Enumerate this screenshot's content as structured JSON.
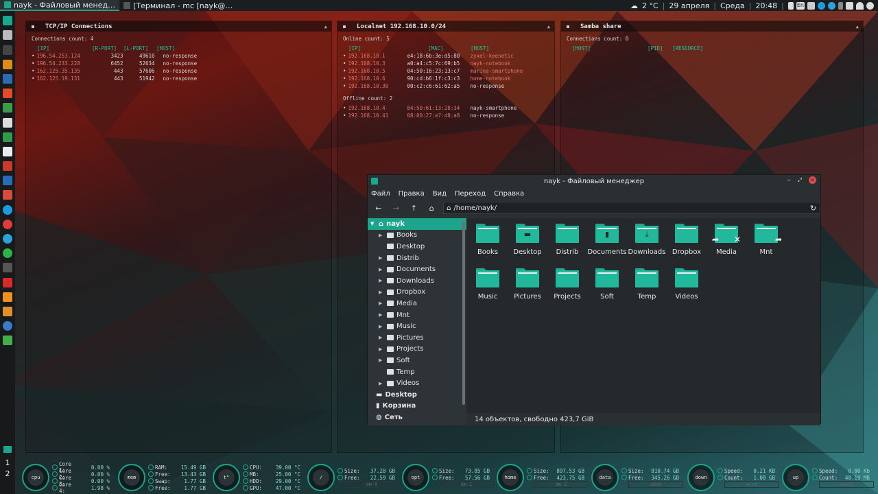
{
  "topbar": {
    "tasks": [
      {
        "label": "nayk - Файловый менед…",
        "active": true
      },
      {
        "label": "[Терминал - mc [nayk@…",
        "active": false
      }
    ],
    "weather": "2 °C",
    "date": "29 апреля",
    "weekday": "Среда",
    "time": "20:48",
    "lang": "En"
  },
  "workspaces": [
    "1",
    "2"
  ],
  "tcp_panel": {
    "title": "TCP/IP Connections",
    "count_label": "Connections count: 4",
    "headers": [
      "[IP]",
      "[R-PORT]",
      "[L-PORT]",
      "[HOST]"
    ],
    "rows": [
      {
        "ip": "196.54.253.124",
        "rport": "3423",
        "lport": "49610",
        "host": "no-response"
      },
      {
        "ip": "196.54.233.228",
        "rport": "6452",
        "lport": "52634",
        "host": "no-response"
      },
      {
        "ip": "162.125.35.135",
        "rport": "443",
        "lport": "57606",
        "host": "no-response"
      },
      {
        "ip": "162.125.19.131",
        "rport": "443",
        "lport": "51942",
        "host": "no-response"
      }
    ]
  },
  "lan_panel": {
    "title": "Localnet 192.168.10.0/24",
    "online_label": "Online count: 5",
    "headers": [
      "[IP]",
      "[MAC]",
      "[HOST]"
    ],
    "online": [
      {
        "ip": "192.168.10.1",
        "mac": "e4:18:6b:3e:d5:80",
        "host": "zyxel-keenetic"
      },
      {
        "ip": "192.168.10.3",
        "mac": "a0:a4:c5:7c:69:b5",
        "host": "nayk-notebook"
      },
      {
        "ip": "192.168.10.5",
        "mac": "04:50:16:23:13:c7",
        "host": "marina-smartphone"
      },
      {
        "ip": "192.168.10.6",
        "mac": "90:cd:b6:1f:c3:c3",
        "host": "home-notebook"
      },
      {
        "ip": "192.168.10.30",
        "mac": "00:c2:c6:61:62:a5",
        "host": "no-response"
      }
    ],
    "offline_label": "Offline count: 2",
    "offline": [
      {
        "ip": "192.168.10.4",
        "mac": "84:50:61:13:28:34",
        "host": "nayk-smartphone"
      },
      {
        "ip": "192.168.10.41",
        "mac": "08:00:27:e7:d8:a8",
        "host": "no-response"
      }
    ]
  },
  "samba_panel": {
    "title": "Samba share",
    "count_label": "Connections count: 0",
    "headers": [
      "[HOST]",
      "[PID]",
      "[RESOURCE]"
    ]
  },
  "filemanager": {
    "title": "nayk - Файловый менеджер",
    "menu": [
      "Файл",
      "Правка",
      "Вид",
      "Переход",
      "Справка"
    ],
    "path": "/home/nayk/",
    "sidebar": {
      "root": "nayk",
      "children": [
        "Books",
        "Desktop",
        "Distrib",
        "Documents",
        "Downloads",
        "Dropbox",
        "Media",
        "Mnt",
        "Music",
        "Pictures",
        "Projects",
        "Soft",
        "Temp",
        "Videos"
      ],
      "places": [
        "Desktop",
        "Корзина",
        "Сеть"
      ]
    },
    "folders": [
      {
        "name": "Books",
        "glyph": ""
      },
      {
        "name": "Desktop",
        "glyph": "▬"
      },
      {
        "name": "Distrib",
        "glyph": ""
      },
      {
        "name": "Documents",
        "glyph": "▮"
      },
      {
        "name": "Downloads",
        "glyph": "⤓"
      },
      {
        "name": "Dropbox",
        "glyph": ""
      },
      {
        "name": "Media",
        "glyph": ""
      },
      {
        "name": "Mnt",
        "glyph": ""
      },
      {
        "name": "Music",
        "glyph": ""
      },
      {
        "name": "Pictures",
        "glyph": ""
      },
      {
        "name": "Projects",
        "glyph": ""
      },
      {
        "name": "Soft",
        "glyph": ""
      },
      {
        "name": "Temp",
        "glyph": ""
      },
      {
        "name": "Videos",
        "glyph": ""
      }
    ],
    "status": "14 объектов, свободно 423,7 GiB"
  },
  "bottom": {
    "cpu": {
      "label": "cpu",
      "rows": [
        [
          "Core 1:",
          "0.00 %"
        ],
        [
          "Core 2:",
          "0.00 %"
        ],
        [
          "Core 3:",
          "0.00 %"
        ],
        [
          "Core 4:",
          "1.98 %"
        ]
      ]
    },
    "mem": {
      "label": "mem",
      "rows": [
        [
          "RAM:",
          "15.49 GB"
        ],
        [
          "Free:",
          "13.43 GB"
        ],
        [
          "Swap:",
          "1.77 GB"
        ],
        [
          "Free:",
          "1.77 GB"
        ]
      ]
    },
    "temp": {
      "label": "t°",
      "rows": [
        [
          "CPU:",
          "39.00 °C"
        ],
        [
          "MB:",
          "25.00 °C"
        ],
        [
          "HDD:",
          "29.00 °C"
        ],
        [
          "GPU:",
          "47.00 °C"
        ]
      ]
    },
    "disk_root": {
      "label": "/",
      "rows": [
        [
          "Size:",
          "37.28 GB"
        ],
        [
          "Free:",
          "22.59 GB"
        ]
      ],
      "dev": "dm-0"
    },
    "disk_opt": {
      "label": "opt",
      "rows": [
        [
          "Size:",
          "73.85 GB"
        ],
        [
          "Free:",
          "57.56 GB"
        ]
      ],
      "dev": "dm-1"
    },
    "disk_home": {
      "label": "home",
      "rows": [
        [
          "Size:",
          "897.53 GB"
        ],
        [
          "Free:",
          "423.75 GB"
        ]
      ],
      "dev": "dm-2"
    },
    "disk_data": {
      "label": "data",
      "rows": [
        [
          "Size:",
          "810.74 GB"
        ],
        [
          "Free:",
          "345.26 GB"
        ]
      ],
      "dev": "sda4"
    },
    "net_down": {
      "label": "down",
      "rows": [
        [
          "Speed:",
          "0.21 KB"
        ],
        [
          "Count:",
          "1.08 GB"
        ]
      ],
      "dev": "wlo1"
    },
    "net_up": {
      "label": "up",
      "rows": [
        [
          "Speed:",
          "0.00 Kb"
        ],
        [
          "Count:",
          "48.19 MB"
        ]
      ],
      "dev": "wlo1"
    }
  }
}
